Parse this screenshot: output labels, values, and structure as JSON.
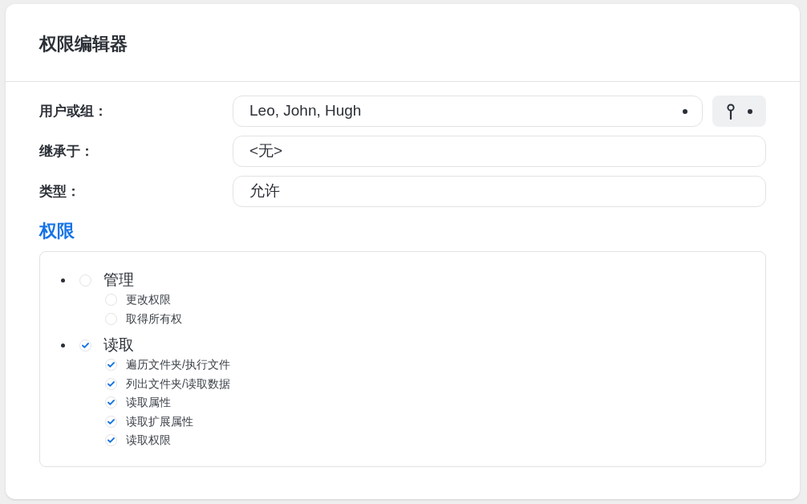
{
  "title": "权限编辑器",
  "fields": [
    {
      "label": "用户或组：",
      "value": "Leo, John, Hugh",
      "kind": "picker"
    },
    {
      "label": "继承于：",
      "value": "<无>",
      "kind": "plain"
    },
    {
      "label": "类型：",
      "value": "允许",
      "kind": "plain"
    }
  ],
  "section_title": "权限",
  "permissions": [
    {
      "label": "管理",
      "checked": false,
      "children": [
        {
          "label": "更改权限",
          "checked": false
        },
        {
          "label": "取得所有权",
          "checked": false
        }
      ]
    },
    {
      "label": "读取",
      "checked": true,
      "children": [
        {
          "label": "遍历文件夹/执行文件",
          "checked": true
        },
        {
          "label": "列出文件夹/读取数据",
          "checked": true
        },
        {
          "label": "读取属性",
          "checked": true
        },
        {
          "label": "读取扩展属性",
          "checked": true
        },
        {
          "label": "读取权限",
          "checked": true
        }
      ]
    }
  ]
}
